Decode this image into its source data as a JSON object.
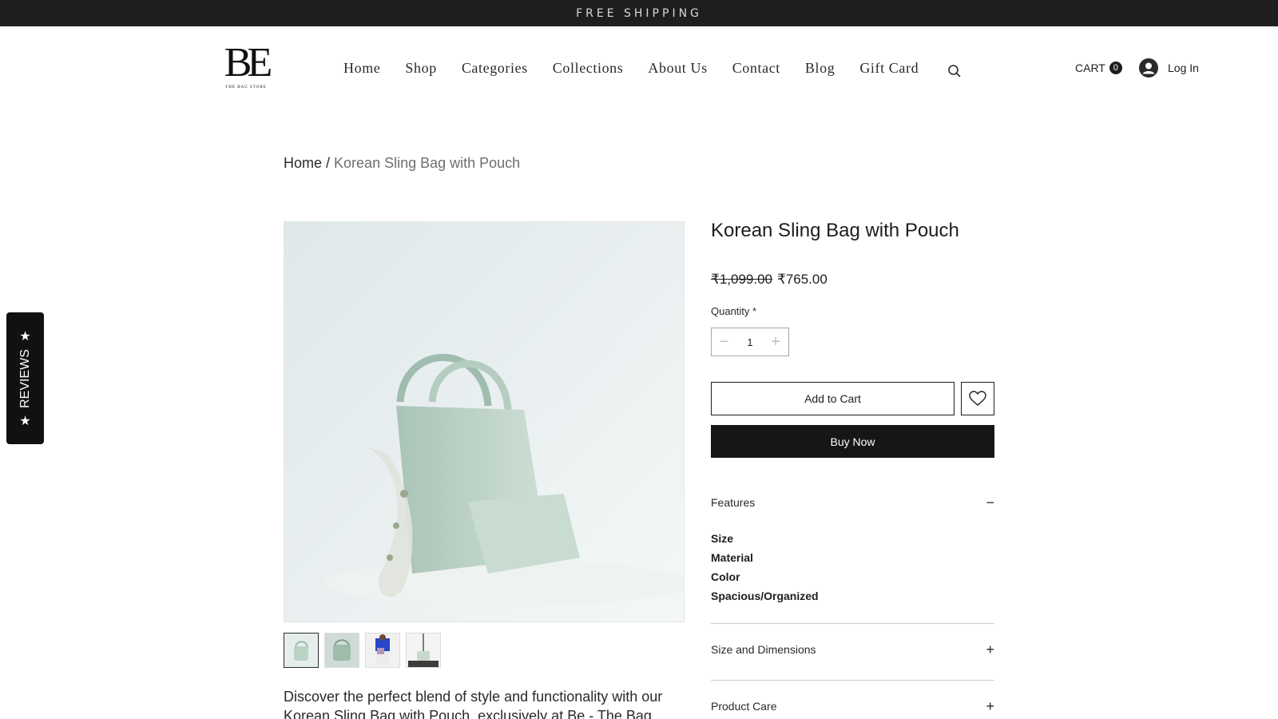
{
  "announcement": "FREE SHIPPING",
  "logo": {
    "mark": "BE",
    "subtitle": "THE BAG STORE"
  },
  "nav": {
    "items": [
      "Home",
      "Shop",
      "Categories",
      "Collections",
      "About Us",
      "Contact",
      "Blog",
      "Gift Card"
    ]
  },
  "cart": {
    "label": "CART",
    "count": "0"
  },
  "login": {
    "label": "Log In"
  },
  "breadcrumb": {
    "home": "Home",
    "separator": "/",
    "current": "Korean Sling Bag with Pouch"
  },
  "reviews_tab": {
    "label": "REVIEWS"
  },
  "product": {
    "title": "Korean Sling Bag with Pouch",
    "price_old": "₹1,099.00",
    "price_new": "₹765.00",
    "quantity_label": "Quantity *",
    "quantity_value": "1",
    "add_to_cart": "Add to Cart",
    "buy_now": "Buy Now",
    "description": "Discover the perfect blend of style and functionality with our Korean Sling Bag with Pouch, exclusively at Be - The Bag"
  },
  "accordion": {
    "features": {
      "title": "Features",
      "toggle": "−",
      "items": [
        "Size",
        "Material",
        "Color",
        "Spacious/Organized"
      ]
    },
    "size": {
      "title": "Size and Dimensions",
      "toggle": "+"
    },
    "care": {
      "title": "Product Care",
      "toggle": "+"
    }
  },
  "colors": {
    "accent": "#161616",
    "topbar": "#1e1e1e",
    "bag": "#b9d3c4"
  }
}
